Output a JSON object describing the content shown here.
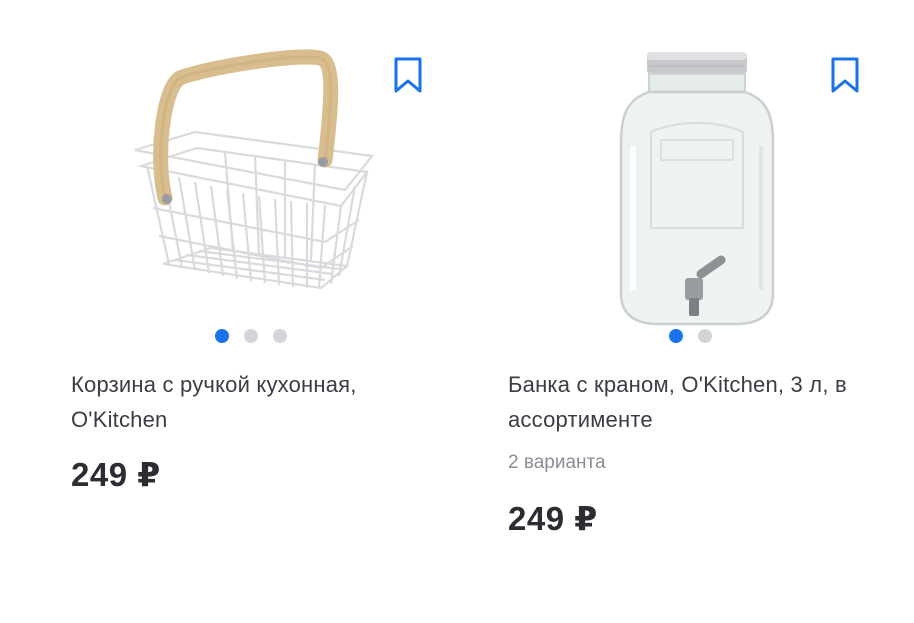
{
  "products": [
    {
      "title": "Корзина с ручкой кухонная, O'Kitchen",
      "price": "249 ₽",
      "image_name": "wire-basket-image",
      "slides": {
        "count": 3,
        "active": 1
      },
      "bookmark_icon": "bookmark-icon"
    },
    {
      "title": "Банка с краном, O'Kitchen, 3 л, в ассортименте",
      "variants": "2 варианта",
      "price": "249 ₽",
      "image_name": "glass-dispenser-jar-image",
      "slides": {
        "count": 2,
        "active": 1
      },
      "bookmark_icon": "bookmark-icon"
    }
  ],
  "colors": {
    "accent": "#1a73e8",
    "text": "#3a3d44",
    "muted": "#8a8d94",
    "dot_inactive": "#d3d5da"
  }
}
